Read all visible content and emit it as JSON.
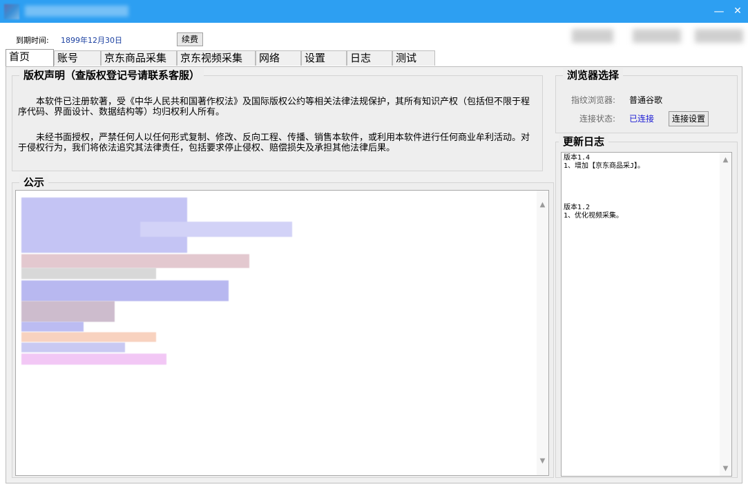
{
  "window": {
    "title": "",
    "minimize_glyph": "—",
    "close_glyph": "✕"
  },
  "topbar": {
    "expiry_label": "到期时间:",
    "expiry_value": "1899年12月30日",
    "renew_label": "续费"
  },
  "tabs": [
    {
      "label": "首页",
      "active": true
    },
    {
      "label": "账号",
      "active": false
    },
    {
      "label": "京东商品采集",
      "active": false
    },
    {
      "label": "京东视频采集",
      "active": false
    },
    {
      "label": "网络",
      "active": false
    },
    {
      "label": "设置",
      "active": false
    },
    {
      "label": "日志",
      "active": false
    },
    {
      "label": "测试",
      "active": false
    }
  ],
  "copyright": {
    "title": "版权声明（查版权登记号请联系客服）",
    "para1": "本软件已注册软著，受《中华人民共和国著作权法》及国际版权公约等相关法律法规保护，其所有知识产权（包括但不限于程序代码、界面设计、数据结构等）均归权利人所有。",
    "para2": "未经书面授权，严禁任何人以任何形式复制、修改、反向工程、传播、销售本软件，或利用本软件进行任何商业牟利活动。对于侵权行为，我们将依法追究其法律责任，包括要求停止侵权、赔偿损失及承担其他法律后果。"
  },
  "notice": {
    "title": "公示"
  },
  "browser": {
    "title": "浏览器选择",
    "fingerprint_label": "指纹浏览器:",
    "fingerprint_value": "普通谷歌",
    "status_label": "连接状态:",
    "status_value": "已连接",
    "status_color": "#1a1ad4",
    "connect_settings_label": "连接设置"
  },
  "changelog": {
    "title": "更新日志",
    "entries": [
      {
        "version": "版本1.4",
        "item": "1、增加【京东商品采J】。"
      },
      {
        "version": "版本1.2",
        "item": "1、优化视频采集。"
      }
    ]
  },
  "icons": {
    "scroll_up": "scroll-up-icon",
    "scroll_down": "scroll-down-icon"
  }
}
